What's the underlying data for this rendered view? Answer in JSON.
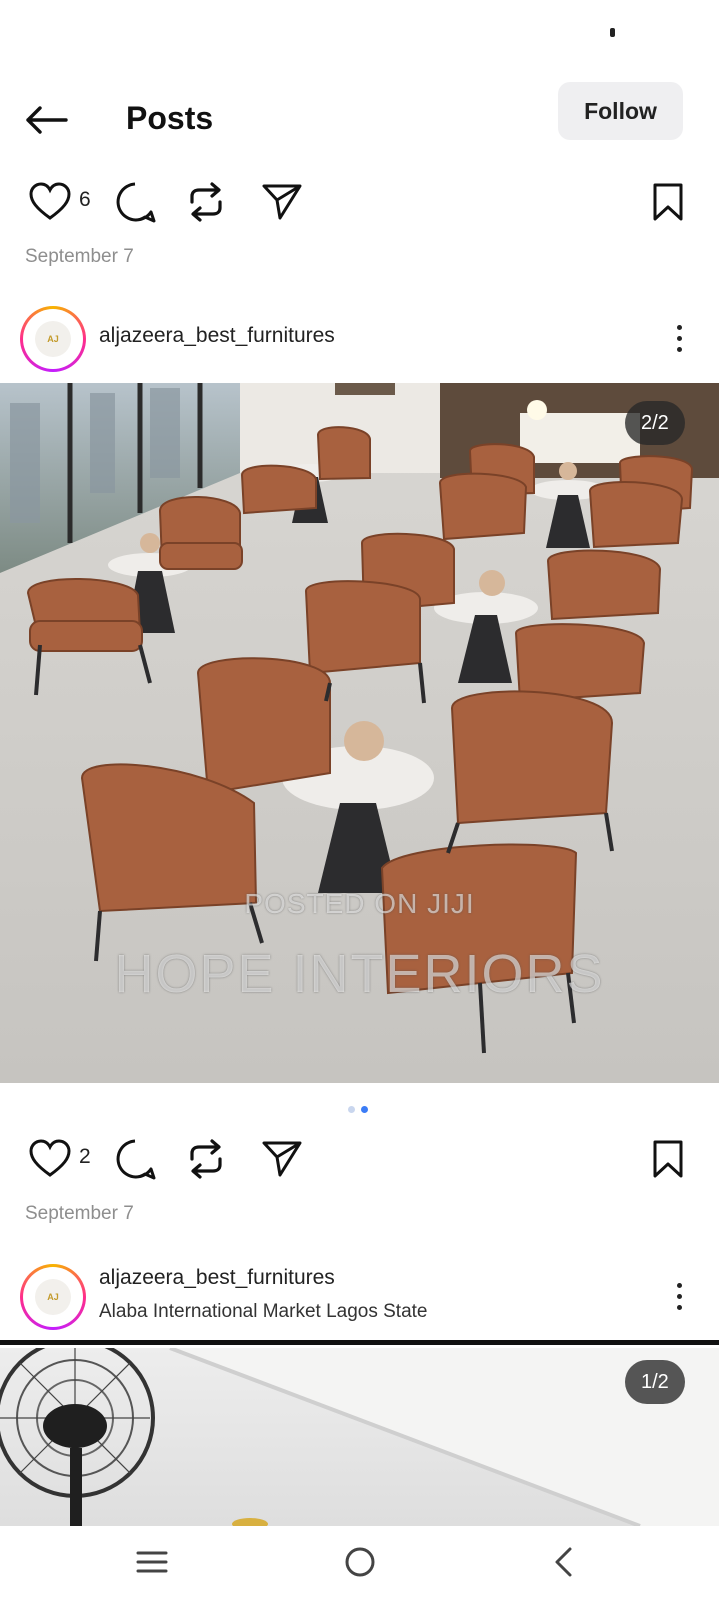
{
  "header": {
    "title": "Posts",
    "follow_label": "Follow"
  },
  "posts": [
    {
      "likes": "6",
      "date": "September 7"
    },
    {
      "username": "aljazeera_best_furnitures",
      "avatar_text": "AJ",
      "image_counter": "2/2",
      "watermark_small": "POSTED ON JIJI",
      "watermark_big": "HOPE INTERIORS",
      "carousel": {
        "count": 2,
        "active": 2
      },
      "likes": "2",
      "date": "September 7"
    },
    {
      "username": "aljazeera_best_furnitures",
      "avatar_text": "AJ",
      "location": "Alaba International Market Lagos State",
      "image_counter": "1/2"
    }
  ],
  "icons": {
    "back": "arrow-left-icon",
    "like": "heart-icon",
    "comment": "comment-icon",
    "repost": "repost-icon",
    "share": "send-icon",
    "save": "bookmark-icon",
    "more": "more-vertical-icon",
    "nav_menu": "menu-icon",
    "nav_home": "home-circle-icon",
    "nav_back": "chevron-left-icon"
  },
  "colors": {
    "accent_dot": "#3b7cf6",
    "muted_dot": "#c9d6ee",
    "date_text": "#8e8e8e",
    "chair_leather": "#a8613f",
    "follow_bg": "#efeff1"
  }
}
